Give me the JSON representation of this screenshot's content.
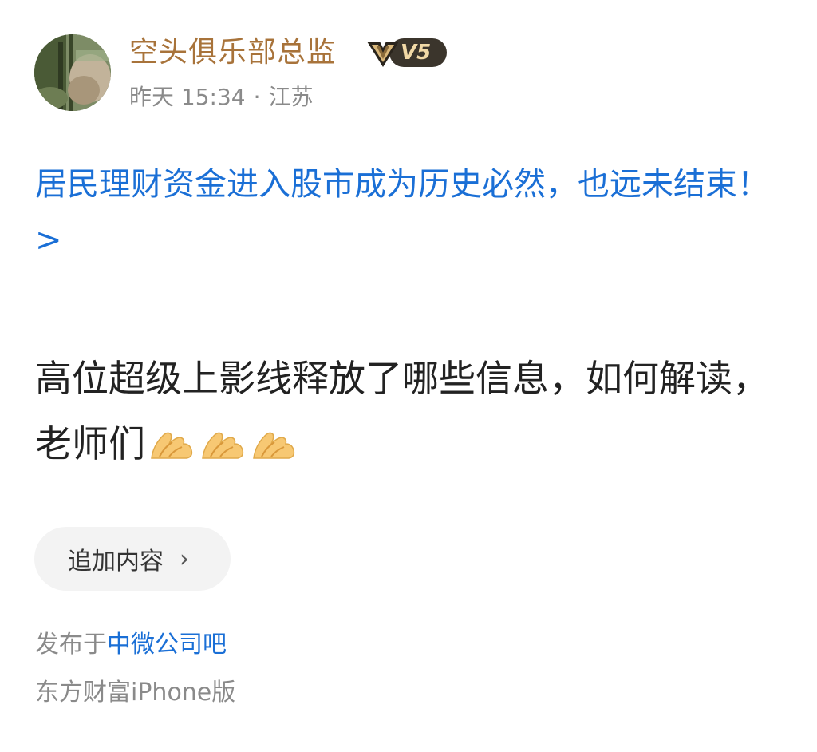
{
  "post": {
    "author": {
      "name": "空头俱乐部总监",
      "level_badge": "V5",
      "avatar": "landscape-avatar"
    },
    "meta": {
      "time": "昨天 15:34",
      "separator": "·",
      "location": "江苏"
    },
    "linked_title": "居民理财资金进入股市成为历史必然，也远未结束！ >",
    "content": "高位超级上影线释放了哪些信息，如何解读，老师们",
    "content_emojis": [
      "praying-hands-emoji",
      "praying-hands-emoji",
      "praying-hands-emoji"
    ],
    "append_button": {
      "label": "追加内容",
      "chevron": "›"
    },
    "posted_in": {
      "prefix": "发布于",
      "forum": "中微公司吧"
    },
    "client": "东方财富iPhone版"
  },
  "colors": {
    "username": "#a8733a",
    "link": "#1a6fd6",
    "meta": "#8a8a8a",
    "body": "#222222",
    "badge_bg": "#3b352c",
    "badge_text": "#f1d9a6"
  }
}
